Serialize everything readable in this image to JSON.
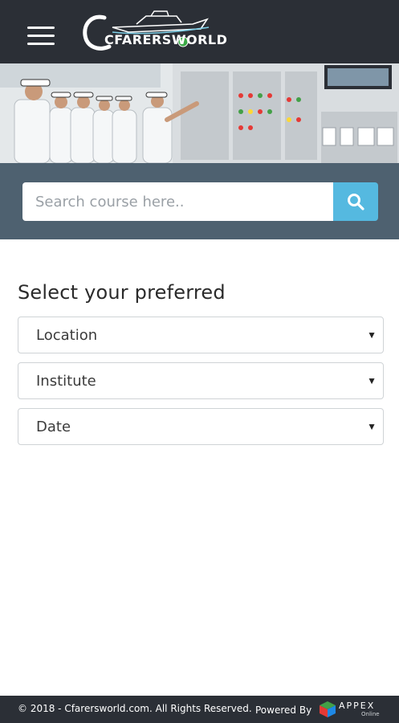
{
  "header": {
    "logo_text": "CFARERSWORLD"
  },
  "search": {
    "placeholder": "Search course here.."
  },
  "filters": {
    "title": "Select your preferred",
    "location_label": "Location",
    "institute_label": "Institute",
    "date_label": "Date"
  },
  "footer": {
    "copyright": "© 2018 - Cfarersworld.com. All Rights Reserved.",
    "powered_by": "Powered By",
    "appex_name": "APPEX",
    "appex_sub": "Online"
  },
  "colors": {
    "topbar": "#2b2f36",
    "search_band": "#4e6170",
    "search_button": "#55b9e0"
  },
  "icons": {
    "menu": "hamburger-menu-icon",
    "search": "magnifier-icon",
    "caret": "caret-down-icon"
  }
}
